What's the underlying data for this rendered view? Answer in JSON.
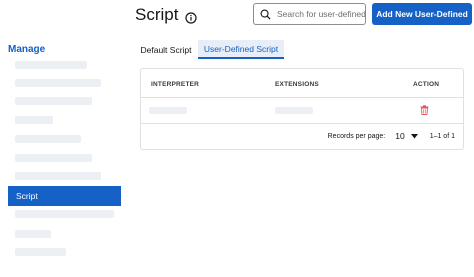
{
  "header": {
    "title": "Script",
    "search_placeholder": "Search for user-defined",
    "add_button_label": "Add New User-Defined"
  },
  "sidebar": {
    "heading": "Manage",
    "active_item": "Script"
  },
  "tabs": [
    {
      "label": "Default Script",
      "selected": false
    },
    {
      "label": "User-Defined Script",
      "selected": true
    }
  ],
  "table": {
    "columns": [
      "INTERPRETER",
      "EXTENSIONS",
      "ACTION"
    ]
  },
  "pagination": {
    "records_label": "Records per page:",
    "per_page": "10",
    "range": "1–1 of 1"
  },
  "colors": {
    "accent": "#1561c6",
    "delete": "#e05a5a",
    "skeleton": "#eceff3"
  },
  "icons": {
    "title_info": "info-icon",
    "search": "search-icon",
    "row_action": "trash-icon",
    "select": "chevron-down-icon"
  }
}
